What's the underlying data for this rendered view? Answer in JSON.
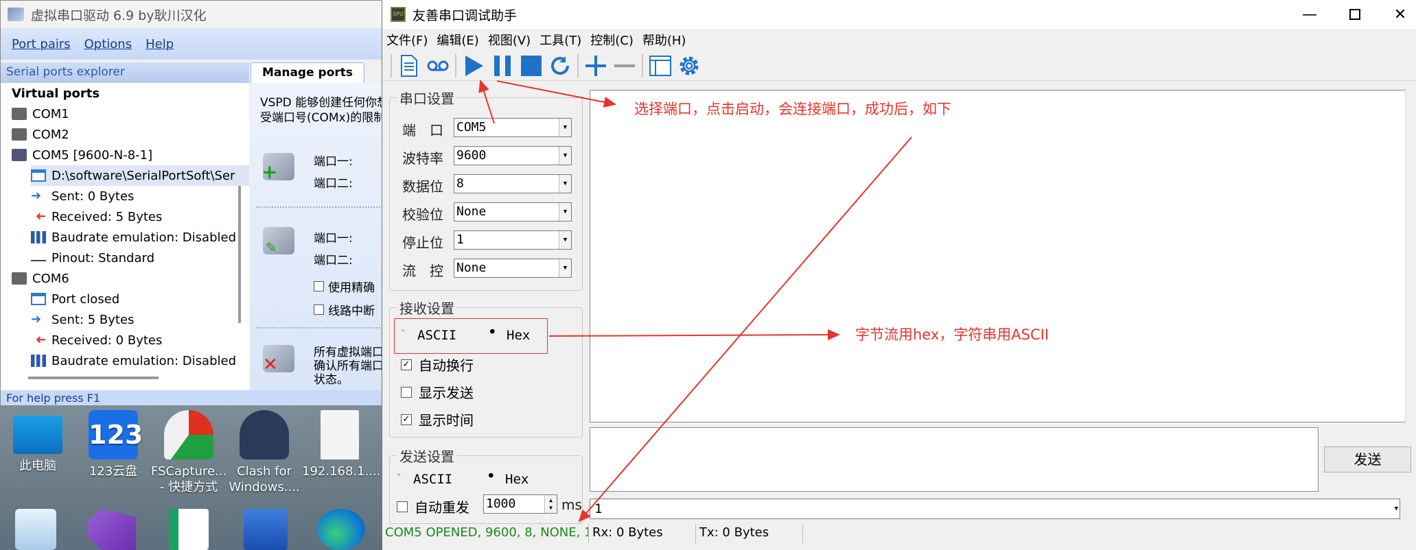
{
  "vspd": {
    "title": "虚拟串口驱动 6.9 by耿川汉化",
    "menu": [
      "Port pairs",
      "Options",
      "Help"
    ],
    "explorer_header": "Serial ports explorer",
    "tab": "Manage ports",
    "tree": {
      "root": "Virtual ports",
      "items": [
        "COM1",
        "COM2",
        "COM5 [9600-N-8-1]",
        "D:\\software\\SerialPortSoft\\Ser",
        "Sent: 0 Bytes",
        "Received: 5 Bytes",
        "Baudrate emulation: Disabled",
        "Pinout: Standard",
        "COM6",
        "Port closed",
        "Sent: 5 Bytes",
        "Received: 0 Bytes",
        "Baudrate emulation: Disabled"
      ]
    },
    "right": {
      "intro_1": "VSPD 能够创建任何你想",
      "intro_2": "受端口号(COMx)的限制",
      "port1": "端口一:",
      "port2": "端口二:",
      "port1b": "端口一:",
      "port2b": "端口二:",
      "check1": "使用精确",
      "check2": "线路中断",
      "footer_1": "所有虚拟端口",
      "footer_2": "确认所有端口",
      "footer_3": "状态。"
    },
    "status": "For help press F1"
  },
  "desktop": {
    "icons": [
      {
        "label_1": "此电脑",
        "label_2": ""
      },
      {
        "label_1": "123云盘",
        "label_2": ""
      },
      {
        "label_1": "FSCapture...",
        "label_2": "- 快捷方式"
      },
      {
        "label_1": "Clash for",
        "label_2": "Windows...."
      },
      {
        "label_1": "192.168.1....",
        "label_2": ""
      }
    ]
  },
  "assistant": {
    "title": "友善串口调试助手",
    "menu": [
      "文件(F)",
      "编辑(E)",
      "视图(V)",
      "工具(T)",
      "控制(C)",
      "帮助(H)"
    ],
    "serial_group": {
      "legend": "串口设置",
      "port_label": "端　口",
      "port_value": "COM5",
      "baud_label": "波特率",
      "baud_value": "9600",
      "data_label": "数据位",
      "data_value": "8",
      "parity_label": "校验位",
      "parity_value": "None",
      "stop_label": "停止位",
      "stop_value": "1",
      "flow_label": "流　控",
      "flow_value": "None"
    },
    "recv_group": {
      "legend": "接收设置",
      "ascii": "ASCII",
      "hex": "Hex",
      "selected": "Hex",
      "auto_wrap": "自动换行",
      "auto_wrap_checked": true,
      "show_send": "显示发送",
      "show_send_checked": false,
      "show_time": "显示时间",
      "show_time_checked": true
    },
    "send_group": {
      "legend": "发送设置",
      "ascii": "ASCII",
      "hex": "Hex",
      "selected": "Hex",
      "auto_resend": "自动重发",
      "auto_resend_checked": false,
      "interval": "1000",
      "unit": "ms"
    },
    "send_button": "发送",
    "history_value": "1",
    "status": {
      "port_state": "COM5 OPENED, 9600, 8, NONE, 1,",
      "rx": "Rx: 0 Bytes",
      "tx": "Tx: 0 Bytes"
    }
  },
  "annotations": {
    "select_port": "选择端口，点击启动，会连接端口，成功后，如下",
    "hex_note": "字节流用hex，字符串用ASCII"
  },
  "colors": {
    "annotation_red": "#e8342c",
    "status_green": "#1a8a1a",
    "toolbar_blue": "#1e73c8",
    "vspd_menu_blue": "#1a3f8a"
  }
}
